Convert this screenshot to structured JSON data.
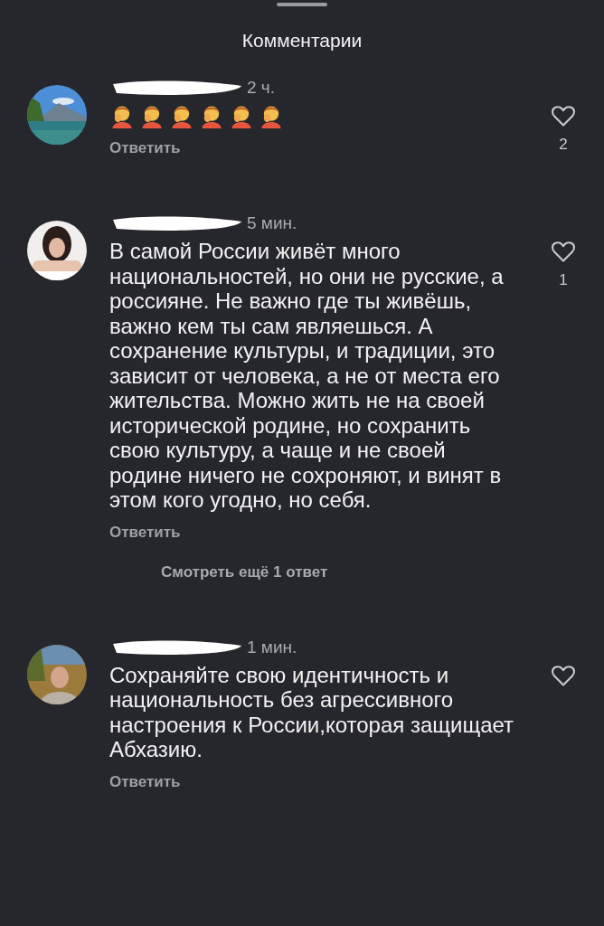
{
  "header": {
    "title": "Комментарии"
  },
  "comments": [
    {
      "time": "2 ч.",
      "kind": "emoji",
      "reply": "Ответить",
      "likes": "2",
      "liked": false
    },
    {
      "time": "5 мин.",
      "kind": "text",
      "text": "В самой России живёт много национальностей, но они не русские, а россияне. Не важно где ты живёшь, важно кем ты сам являешься. А сохранение культуры, и традиции, это зависит от человека, а не от места его жительства. Можно жить не на своей исторической родине, но сохранить свою культуру, а чаще и не своей родине ничего не сохроняют, и винят в этом кого угодно, но себя.",
      "reply": "Ответить",
      "likes": "1",
      "liked": false,
      "more_replies": "Смотреть ещё 1 ответ"
    },
    {
      "time": "1 мин.",
      "kind": "text",
      "text": "Сохраняйте свою идентичность и национальность без агрессивного настроения к России,которая защищает Абхазию.",
      "reply": "Ответить",
      "liked": false
    }
  ]
}
